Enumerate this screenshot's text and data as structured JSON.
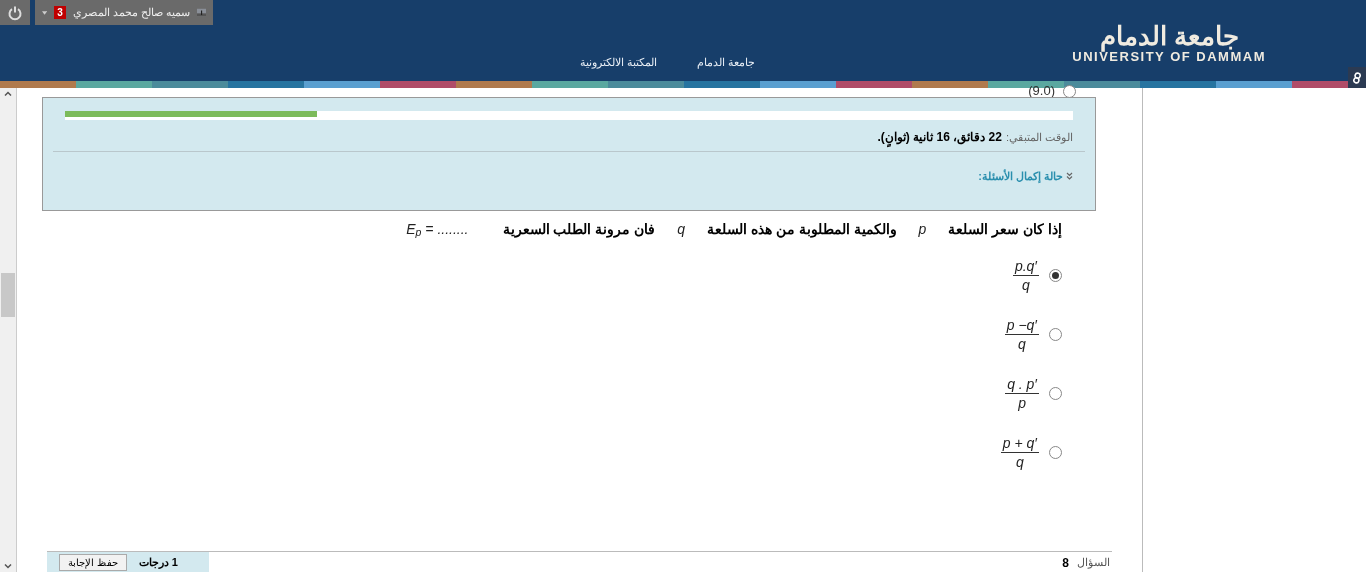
{
  "user_bar": {
    "name": "سميه صالح محمد المصري",
    "notifications": "3"
  },
  "header": {
    "logo_arabic": "جامعة الدمام",
    "logo_english": "UNIVERSITY OF DAMMAM",
    "nav": [
      {
        "label": "جامعة الدمام"
      },
      {
        "label": "المكتبة الالكترونية"
      }
    ]
  },
  "previous_option": {
    "text": "(9.0)",
    "selected": false
  },
  "timer": {
    "level": 0.25,
    "label": "الوقت المتبقي:",
    "value": "22 دقائق، 16 ثانية (ثوانٍ).",
    "status_link": "حالة إكمال الأسئلة:"
  },
  "question": {
    "parts": [
      {
        "kind": "text",
        "text": "إذا كان سعر السلعة"
      },
      {
        "kind": "var",
        "text": "p"
      },
      {
        "kind": "text",
        "text": "والكمية المطلوبة من هذه السلعة"
      },
      {
        "kind": "var",
        "text": "q"
      },
      {
        "kind": "text",
        "text": "فان مرونة الطلب السعرية"
      },
      {
        "kind": "math",
        "text": "E$_{p}$ = ........"
      }
    ],
    "options": [
      {
        "numerator": "p.q′",
        "denominator": "q",
        "selected": true
      },
      {
        "numerator": "p −q′",
        "denominator": "q",
        "selected": false
      },
      {
        "numerator": "q . p′",
        "denominator": "p",
        "selected": false
      },
      {
        "numerator": "p + q′",
        "denominator": "q",
        "selected": false
      }
    ]
  },
  "footer": {
    "question_label": "السؤال",
    "question_number": "8",
    "points": "1 درجات",
    "save_button": "حفظ الإجابة"
  }
}
